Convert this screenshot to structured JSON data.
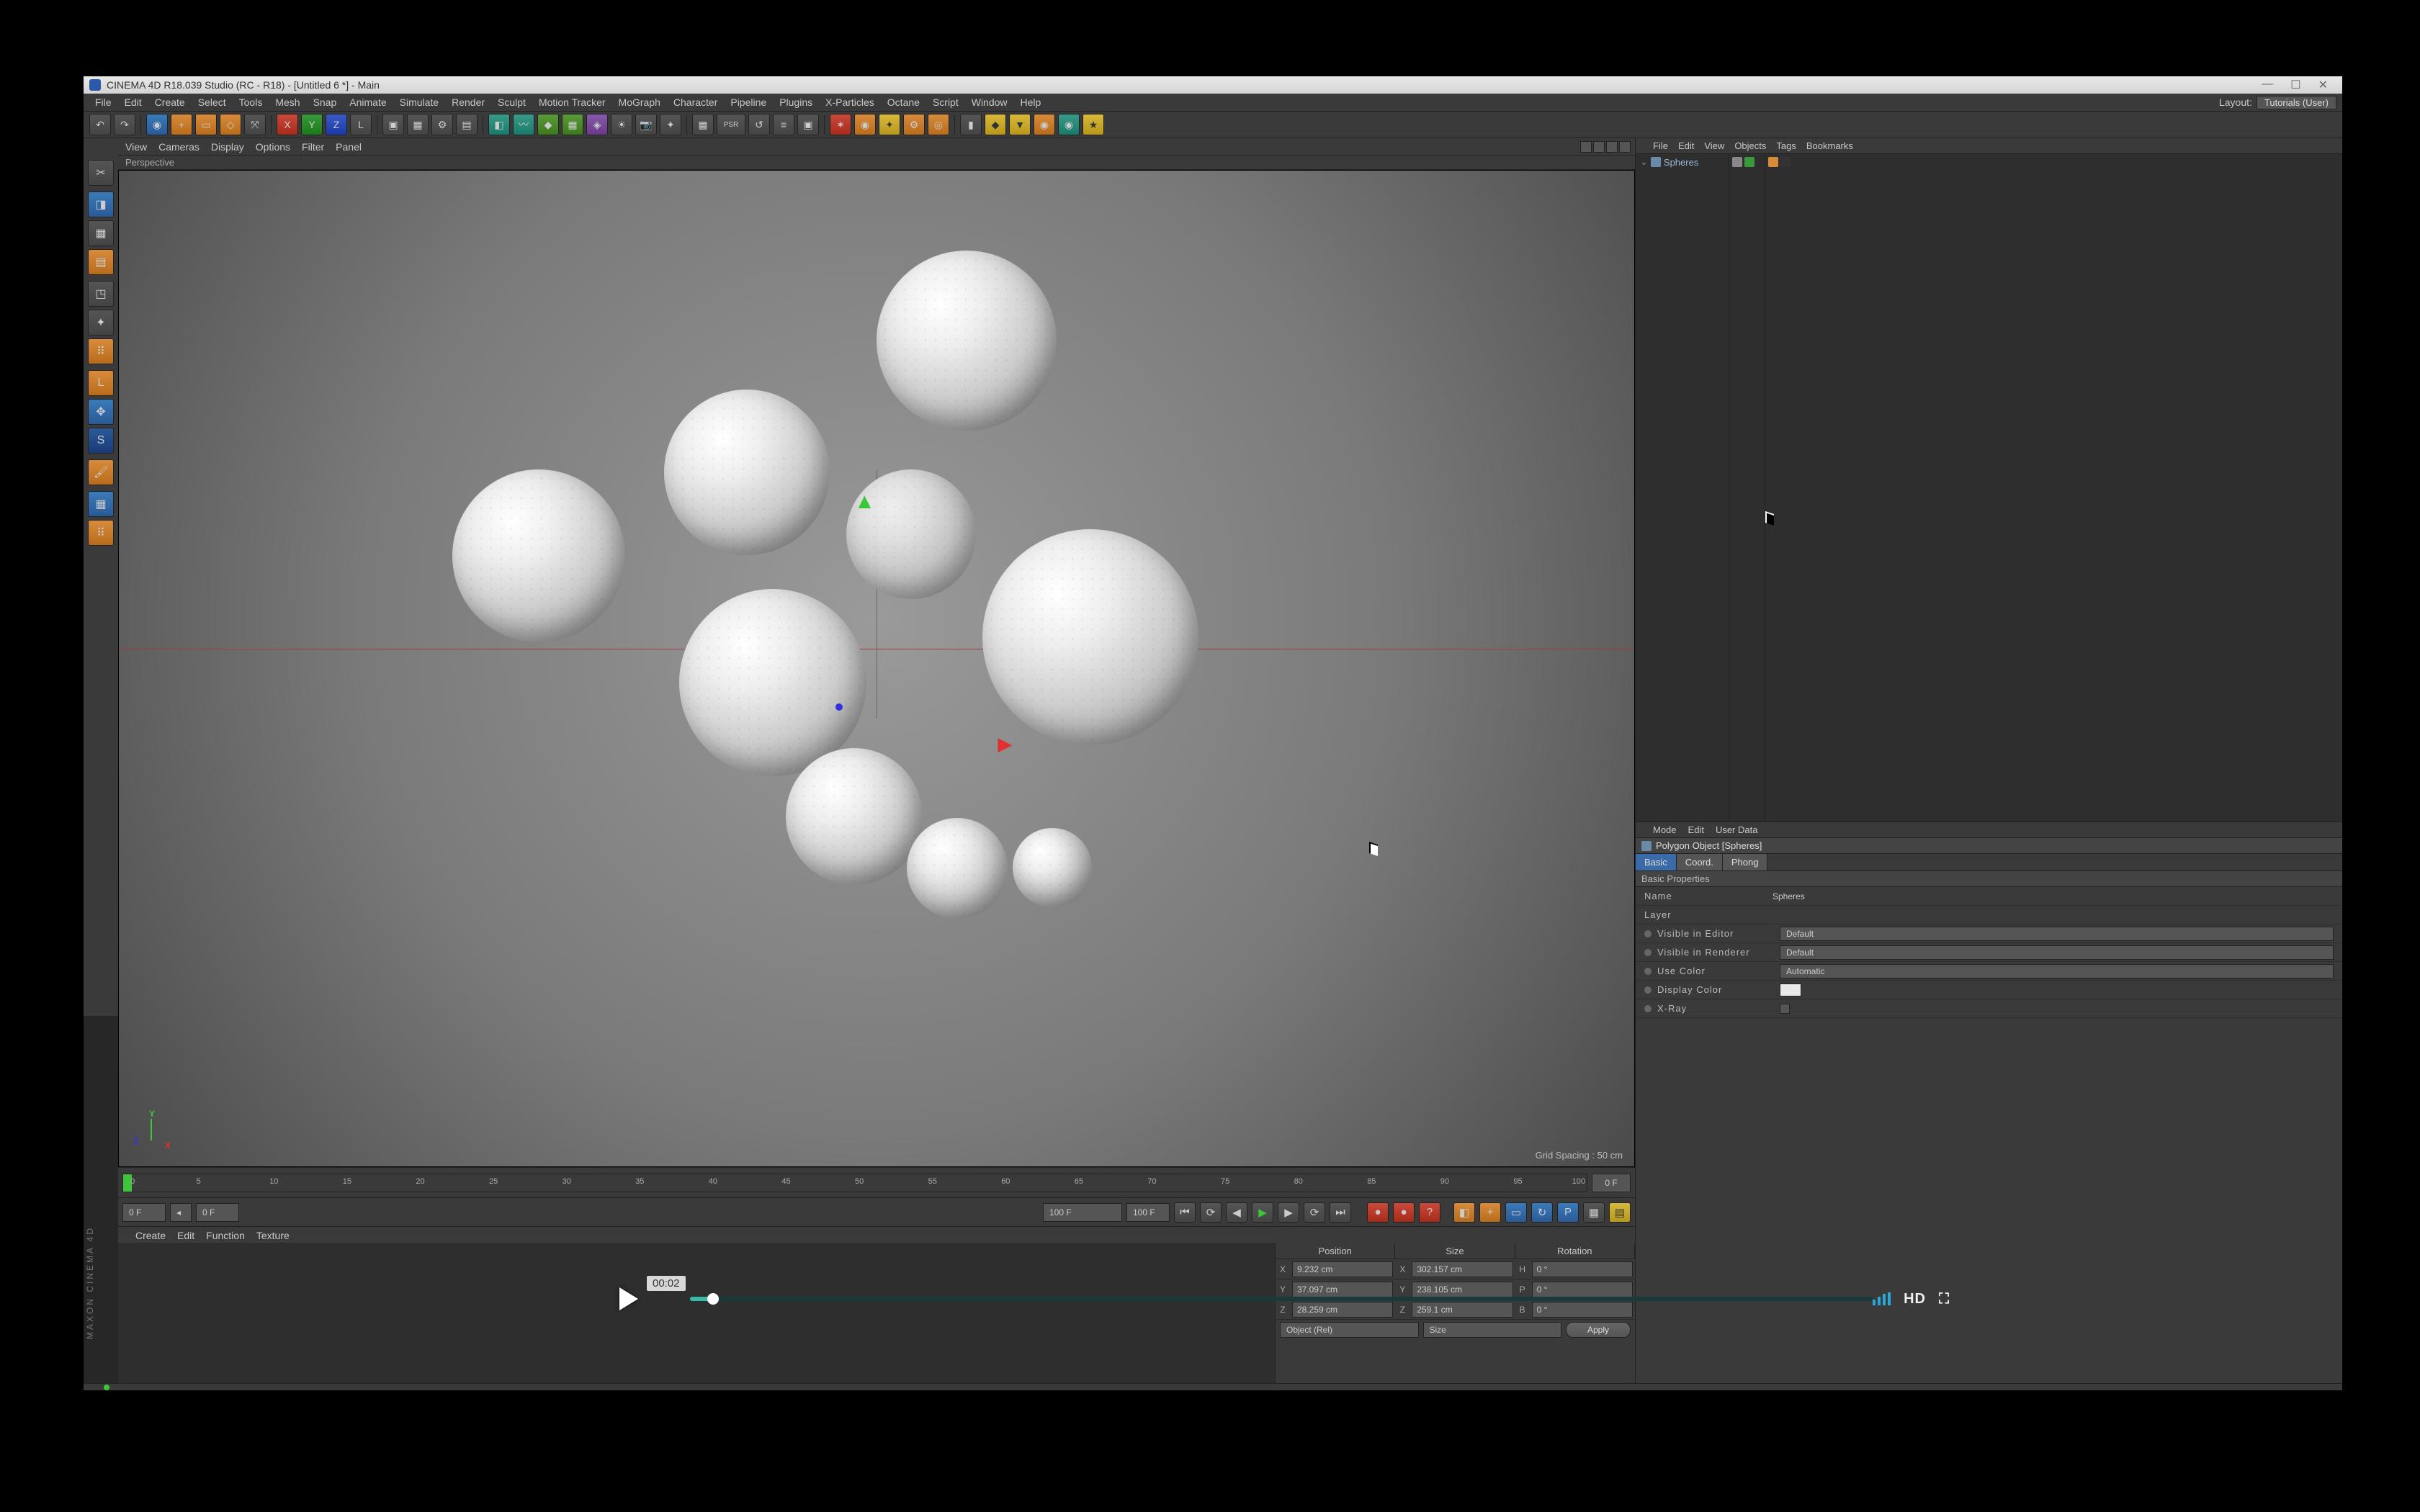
{
  "app": {
    "title": "CINEMA 4D R18.039 Studio (RC - R18) - [Untitled 6 *] - Main",
    "brand_vertical": "MAXON  CINEMA 4D"
  },
  "main_menu": {
    "items": [
      "File",
      "Edit",
      "Create",
      "Select",
      "Tools",
      "Mesh",
      "Snap",
      "Animate",
      "Simulate",
      "Render",
      "Sculpt",
      "Motion Tracker",
      "MoGraph",
      "Character",
      "Pipeline",
      "Plugins",
      "X-Particles",
      "Octane",
      "Script",
      "Window",
      "Help"
    ],
    "layout_label": "Layout:",
    "layout_value": "Tutorials (User)"
  },
  "toolbar": {
    "undo": "↶",
    "redo": "↷",
    "live_select": "◉",
    "rect": "+",
    "lasso": "▭",
    "poly": "◇",
    "move": "⤧",
    "axis_x": "X",
    "axis_y": "Y",
    "axis_z": "Z",
    "axis_l": "L",
    "psr": "PSR",
    "render": "▣",
    "render_region": "▦",
    "render_settings": "⚙",
    "cube": "◧",
    "sphere": "●",
    "spline": "〰",
    "nurbs": "◆",
    "array": "▦",
    "deform": "◈",
    "env": "☀",
    "cam": "📷",
    "light": "✦",
    "xp1": "xp",
    "xp2": "xp",
    "oc1": "◎",
    "oc2": "◎",
    "oc3": "◎",
    "oc4": "◎",
    "ext1": "▣",
    "ext2": "▣",
    "ext3": "▣",
    "ext4": "▣",
    "ext5": "▣"
  },
  "left_tools": {
    "make_editable": "✎",
    "model": "▭",
    "texture": "▦",
    "workplane": "▤",
    "object": "◳",
    "points": "⠿",
    "edges": "╱",
    "polys": "▰",
    "axis": "L",
    "tweak": "✥",
    "softsel": "S",
    "sculpt": "🖌",
    "uvpoly": "▦",
    "uvpoint": "⠿"
  },
  "viewport": {
    "menu": [
      "View",
      "Cameras",
      "Display",
      "Options",
      "Filter",
      "Panel"
    ],
    "label": "Perspective",
    "grid_spacing": "Grid Spacing : 50 cm",
    "axis": {
      "x": "X",
      "y": "Y",
      "z": "Z"
    },
    "cursor1_pos": "911, 432"
  },
  "timeline": {
    "current_field": "0 F",
    "marks": [
      "0",
      "5",
      "10",
      "15",
      "20",
      "25",
      "30",
      "35",
      "40",
      "45",
      "50",
      "55",
      "60",
      "65",
      "70",
      "75",
      "80",
      "85",
      "90",
      "95",
      "100"
    ],
    "end_label": "100",
    "cur_frame_box": "0 F"
  },
  "playback": {
    "start": "0 F",
    "cur": "0 F",
    "end1": "100 F",
    "end2": "100 F",
    "buttons": {
      "gotostart": "⏮",
      "loop": "⟳",
      "prevframe": "◀",
      "play": "▶",
      "nextframe": "▶",
      "gotoend": "⟳",
      "end": "⏭",
      "rec": "●",
      "autokey": "●",
      "keyhelp": "?",
      "sel": "◧",
      "pos": "+",
      "scale": "▭",
      "rot": "↻",
      "pla": "P",
      "opt": "▦",
      "lay": "▤"
    }
  },
  "materials_menu": [
    "Create",
    "Edit",
    "Function",
    "Texture"
  ],
  "coord": {
    "headers": [
      "Position",
      "Size",
      "Rotation"
    ],
    "rows": [
      {
        "axis": "X",
        "axis2": "X",
        "axis3": "H",
        "p": "9.232 cm",
        "s": "302.157 cm",
        "r": "0 °"
      },
      {
        "axis": "Y",
        "axis2": "Y",
        "axis3": "P",
        "p": "37.097 cm",
        "s": "238.105 cm",
        "r": "0 °"
      },
      {
        "axis": "Z",
        "axis2": "Z",
        "axis3": "B",
        "p": "28.259 cm",
        "s": "259.1 cm",
        "r": "0 °"
      }
    ],
    "space": "Object (Rel)",
    "sizemode": "Size",
    "apply": "Apply"
  },
  "object_manager": {
    "menu": [
      "File",
      "Edit",
      "View",
      "Objects",
      "Tags",
      "Bookmarks"
    ],
    "items": [
      {
        "name": "Spheres"
      }
    ],
    "cursor2_pos": "1060, 314"
  },
  "attribute_manager": {
    "menu": [
      "Mode",
      "Edit",
      "User Data"
    ],
    "header": "Polygon Object [Spheres]",
    "tabs": [
      "Basic",
      "Coord.",
      "Phong"
    ],
    "active_tab": 0,
    "group": "Basic Properties",
    "props": {
      "name_label": "Name",
      "name_value": "Spheres",
      "layer_label": "Layer",
      "layer_value": "",
      "vis_editor_label": "Visible in Editor",
      "vis_editor_value": "Default",
      "vis_render_label": "Visible in Renderer",
      "vis_render_value": "Default",
      "use_color_label": "Use Color",
      "use_color_value": "Automatic",
      "disp_color_label": "Display Color",
      "disp_color_value": "#e8e8e8",
      "xray_label": "X-Ray",
      "xray_value": false
    }
  },
  "video": {
    "time": "00:02",
    "hd": "HD",
    "fullscreen": "⛶"
  }
}
